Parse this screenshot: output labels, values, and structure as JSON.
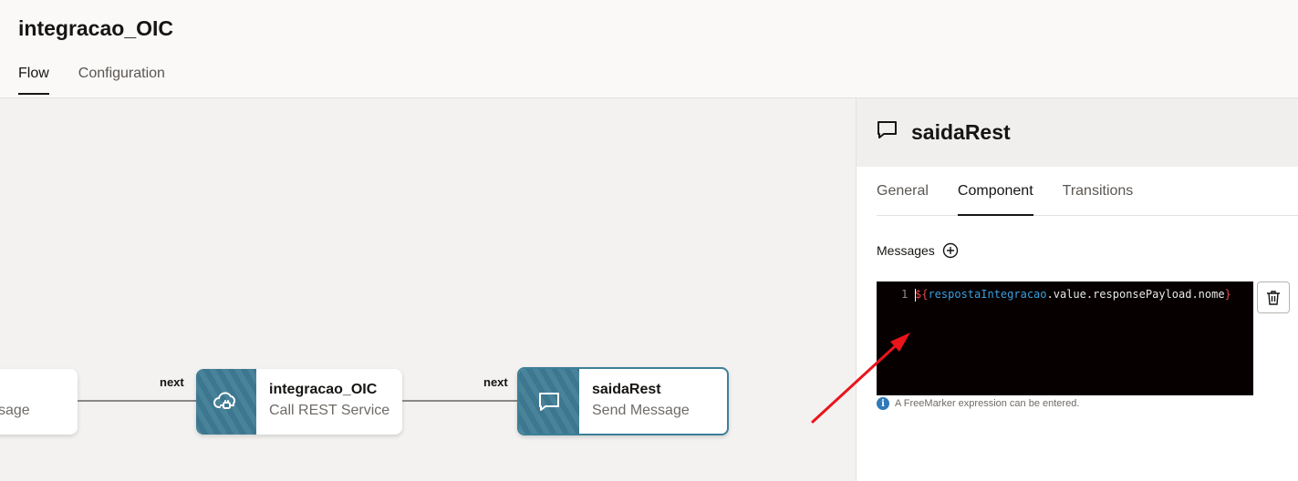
{
  "header": {
    "title": "integracao_OIC",
    "tabs": [
      {
        "label": "Flow",
        "active": true
      },
      {
        "label": "Configuration",
        "active": false
      }
    ]
  },
  "flow": {
    "partial_node": {
      "type_text": "ssage"
    },
    "nodes": [
      {
        "name": "integracao_OIC",
        "type": "Call REST Service",
        "icon": "cloud-plug-icon"
      },
      {
        "name": "saidaRest",
        "type": "Send Message",
        "icon": "message-icon",
        "selected": true
      }
    ],
    "connections": [
      {
        "label": "next"
      },
      {
        "label": "next"
      }
    ]
  },
  "panel": {
    "title": "saidaRest",
    "icon": "message-icon",
    "tabs": [
      {
        "label": "General",
        "active": false
      },
      {
        "label": "Component",
        "active": true
      },
      {
        "label": "Transitions",
        "active": false
      }
    ],
    "messages_label": "Messages",
    "editor": {
      "line_number": "1",
      "open": "${",
      "var": "respostaIntegracao",
      "rest": ".value.responsePayload.nome",
      "close": "}"
    },
    "hint": "A FreeMarker expression can be entered."
  },
  "colors": {
    "node_accent": "#3f7c95",
    "arrow": "#e8151b",
    "editor_bg": "#060000"
  }
}
